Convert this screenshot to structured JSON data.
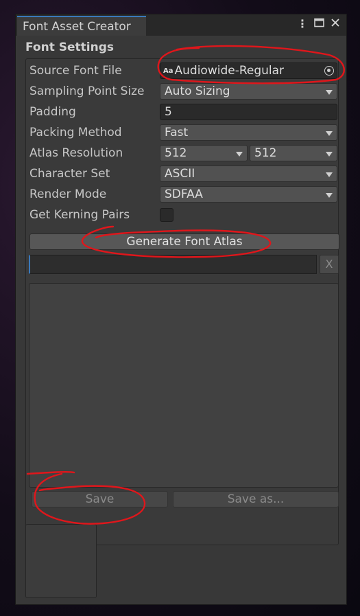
{
  "window": {
    "tab_title": "Font Asset Creator",
    "menu_icon": "kebab-menu-icon",
    "maximize_icon": "maximize-icon",
    "close_icon": "close-icon"
  },
  "section": {
    "title": "Font Settings"
  },
  "fields": {
    "source_font_file": {
      "label": "Source Font File",
      "value": "Audiowide-Regular",
      "type_badge": "Aa"
    },
    "sampling_point_size": {
      "label": "Sampling Point Size",
      "value": "Auto Sizing"
    },
    "padding": {
      "label": "Padding",
      "value": "5"
    },
    "packing_method": {
      "label": "Packing Method",
      "value": "Fast"
    },
    "atlas_resolution": {
      "label": "Atlas Resolution",
      "width": "512",
      "height": "512"
    },
    "character_set": {
      "label": "Character Set",
      "value": "ASCII"
    },
    "render_mode": {
      "label": "Render Mode",
      "value": "SDFAA"
    },
    "get_kerning_pairs": {
      "label": "Get Kerning Pairs",
      "checked": false
    }
  },
  "actions": {
    "generate": "Generate Font Atlas",
    "cancel": "X",
    "save": "Save",
    "save_as": "Save as..."
  },
  "colors": {
    "window_bg": "#383838",
    "accent": "#3a79bb",
    "annotation": "#e0161b"
  }
}
